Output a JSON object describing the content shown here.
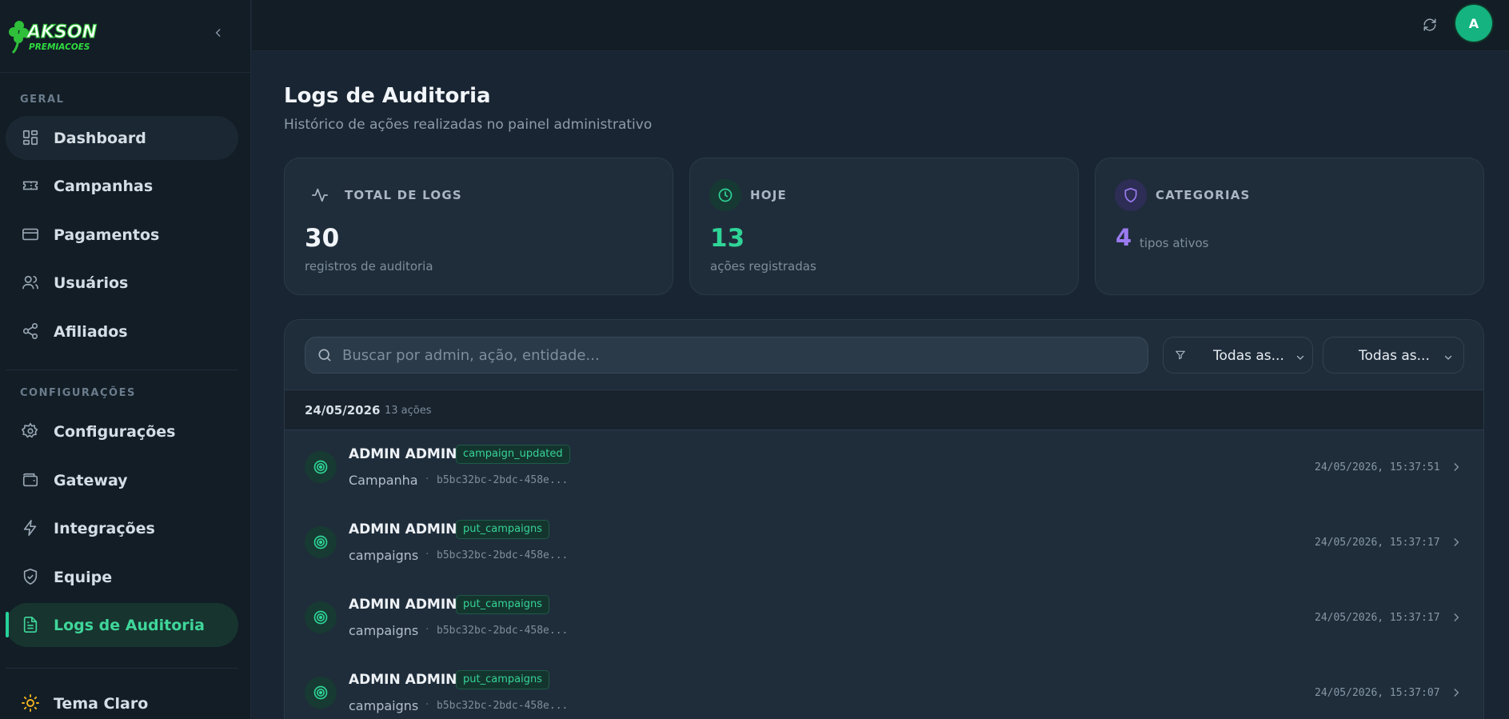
{
  "brand": {
    "line1": "AKSON",
    "line2": "PREMIACOES"
  },
  "sidebar": {
    "section_general": "GERAL",
    "section_config": "CONFIGURAÇÕES",
    "items": [
      {
        "label": "Dashboard",
        "icon": "dashboard-icon"
      },
      {
        "label": "Campanhas",
        "icon": "ticket-icon"
      },
      {
        "label": "Pagamentos",
        "icon": "credit-card-icon"
      },
      {
        "label": "Usuários",
        "icon": "users-icon"
      },
      {
        "label": "Afiliados",
        "icon": "share-icon"
      },
      {
        "label": "Configurações",
        "icon": "gear-icon"
      },
      {
        "label": "Gateway",
        "icon": "wallet-icon"
      },
      {
        "label": "Integrações",
        "icon": "lightning-icon"
      },
      {
        "label": "Equipe",
        "icon": "shield-check-icon"
      },
      {
        "label": "Logs de Auditoria",
        "icon": "file-text-icon"
      }
    ],
    "theme_label": "Tema Claro"
  },
  "topbar": {
    "avatar_initial": "A"
  },
  "page": {
    "title": "Logs de Auditoria",
    "subtitle": "Histórico de ações realizadas no painel administrativo"
  },
  "stats": [
    {
      "label": "TOTAL DE LOGS",
      "value": "30",
      "desc": "registros de auditoria"
    },
    {
      "label": "HOJE",
      "value": "13",
      "desc": "ações registradas"
    },
    {
      "label": "CATEGORIAS",
      "value": "4",
      "desc": "tipos ativos"
    }
  ],
  "filters": {
    "search_placeholder": "Buscar por admin, ação, entidade...",
    "filter1": "Todas as...",
    "filter2": "Todas as..."
  },
  "group": {
    "date": "24/05/2026",
    "count": "13 ações"
  },
  "logs": [
    {
      "admin": "ADMIN ADMIN",
      "action": "campaign_updated",
      "entity": "Campanha",
      "entity_id": "b5bc32bc-2bdc-458e...",
      "timestamp": "24/05/2026, 15:37:51"
    },
    {
      "admin": "ADMIN ADMIN",
      "action": "put_campaigns",
      "entity": "campaigns",
      "entity_id": "b5bc32bc-2bdc-458e...",
      "timestamp": "24/05/2026, 15:37:17"
    },
    {
      "admin": "ADMIN ADMIN",
      "action": "put_campaigns",
      "entity": "campaigns",
      "entity_id": "b5bc32bc-2bdc-458e...",
      "timestamp": "24/05/2026, 15:37:17"
    },
    {
      "admin": "ADMIN ADMIN",
      "action": "put_campaigns",
      "entity": "campaigns",
      "entity_id": "b5bc32bc-2bdc-458e...",
      "timestamp": "24/05/2026, 15:37:07"
    }
  ],
  "colors": {
    "accent": "#27d19a",
    "purple": "#9b7bf0",
    "bg": "#192532",
    "sidebar": "#121d26"
  }
}
